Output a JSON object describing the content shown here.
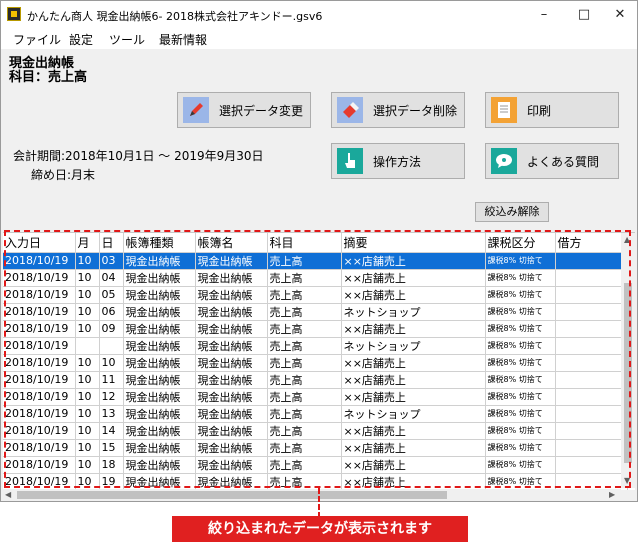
{
  "window": {
    "title": "かんたん商人 現金出納帳6- 2018株式会社アキンドー.gsv6",
    "controls": {
      "minimize": "–",
      "maximize": "□",
      "close": "✕"
    }
  },
  "menu": [
    "ファイル",
    "設定",
    "ツール",
    "最新情報"
  ],
  "header": {
    "ledger": "現金出納帳",
    "subject": "科目：売上高"
  },
  "buttons": {
    "change": "選択データ変更",
    "delete": "選択データ削除",
    "print": "印刷",
    "howto": "操作方法",
    "faq": "よくある質問",
    "clear_filter": "絞込み解除"
  },
  "period": {
    "text": "会計期間:2018年10月1日 ～ 2019年9月30日",
    "closing": "締め日:月末"
  },
  "icons": {
    "pencil": "pencil-icon",
    "eraser": "eraser-icon",
    "printer": "printer-icon",
    "hand": "hand-pointer-icon",
    "faq": "speech-bubble-icon"
  },
  "table": {
    "columns": [
      "入力日",
      "月",
      "日",
      "帳簿種類",
      "帳簿名",
      "科目",
      "摘要",
      "課税区分",
      "借方"
    ],
    "rows": [
      [
        "2018/10/19",
        "10",
        "03",
        "現金出納帳",
        "現金出納帳",
        "売上高",
        "××店舗売上",
        "課税8% 切捨て",
        ""
      ],
      [
        "2018/10/19",
        "10",
        "04",
        "現金出納帳",
        "現金出納帳",
        "売上高",
        "××店舗売上",
        "課税8% 切捨て",
        ""
      ],
      [
        "2018/10/19",
        "10",
        "05",
        "現金出納帳",
        "現金出納帳",
        "売上高",
        "××店舗売上",
        "課税8% 切捨て",
        ""
      ],
      [
        "2018/10/19",
        "10",
        "06",
        "現金出納帳",
        "現金出納帳",
        "売上高",
        "ネットショップ",
        "課税8% 切捨て",
        ""
      ],
      [
        "2018/10/19",
        "10",
        "09",
        "現金出納帳",
        "現金出納帳",
        "売上高",
        "××店舗売上",
        "課税8% 切捨て",
        ""
      ],
      [
        "2018/10/19",
        "",
        "",
        "現金出納帳",
        "現金出納帳",
        "売上高",
        "ネットショップ",
        "課税8% 切捨て",
        ""
      ],
      [
        "2018/10/19",
        "10",
        "10",
        "現金出納帳",
        "現金出納帳",
        "売上高",
        "××店舗売上",
        "課税8% 切捨て",
        ""
      ],
      [
        "2018/10/19",
        "10",
        "11",
        "現金出納帳",
        "現金出納帳",
        "売上高",
        "××店舗売上",
        "課税8% 切捨て",
        ""
      ],
      [
        "2018/10/19",
        "10",
        "12",
        "現金出納帳",
        "現金出納帳",
        "売上高",
        "××店舗売上",
        "課税8% 切捨て",
        ""
      ],
      [
        "2018/10/19",
        "10",
        "13",
        "現金出納帳",
        "現金出納帳",
        "売上高",
        "ネットショップ",
        "課税8% 切捨て",
        ""
      ],
      [
        "2018/10/19",
        "10",
        "14",
        "現金出納帳",
        "現金出納帳",
        "売上高",
        "××店舗売上",
        "課税8% 切捨て",
        ""
      ],
      [
        "2018/10/19",
        "10",
        "15",
        "現金出納帳",
        "現金出納帳",
        "売上高",
        "××店舗売上",
        "課税8% 切捨て",
        ""
      ],
      [
        "2018/10/19",
        "10",
        "18",
        "現金出納帳",
        "現金出納帳",
        "売上高",
        "××店舗売上",
        "課税8% 切捨て",
        ""
      ],
      [
        "2018/10/19",
        "10",
        "19",
        "現金出納帳",
        "現金出納帳",
        "売上高",
        "××店舗売上",
        "課税8% 切捨て",
        ""
      ]
    ],
    "selected_row": 0
  },
  "callout": "絞り込まれたデータが表示されます",
  "colors": {
    "selection": "#0f6fd6",
    "annotation": "#e02020"
  }
}
